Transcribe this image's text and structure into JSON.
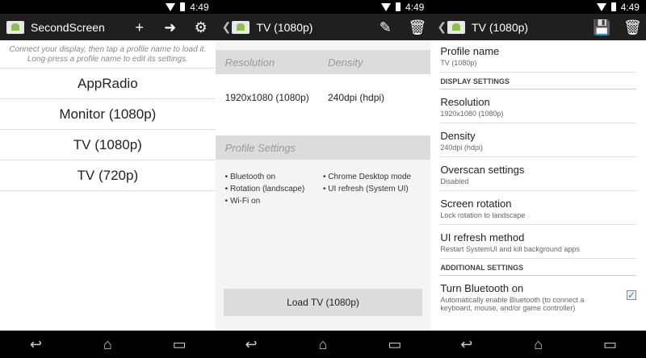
{
  "status": {
    "time": "4:49"
  },
  "screen1": {
    "title": "SecondScreen",
    "hint": "Connect your display, then tap a profile name to load it. Long-press a profile name to edit its settings.",
    "profiles": [
      "AppRadio",
      "Monitor (1080p)",
      "TV (1080p)",
      "TV (720p)"
    ]
  },
  "screen2": {
    "title": "TV (1080p)",
    "hdr": {
      "resolution": "Resolution",
      "density": "Density"
    },
    "vals": {
      "resolution": "1920x1080 (1080p)",
      "density": "240dpi (hdpi)"
    },
    "profile_settings": "Profile Settings",
    "bullets_left": [
      "Bluetooth on",
      "Rotation (landscape)",
      "Wi-Fi on"
    ],
    "bullets_right": [
      "Chrome Desktop mode",
      "UI refresh (System UI)"
    ],
    "load_button": "Load TV (1080p)"
  },
  "screen3": {
    "title": "TV (1080p)",
    "profile_name": {
      "title": "Profile name",
      "value": "TV (1080p)"
    },
    "cat_display": "DISPLAY SETTINGS",
    "resolution": {
      "title": "Resolution",
      "value": "1920x1080 (1080p)"
    },
    "density": {
      "title": "Density",
      "value": "240dpi (hdpi)"
    },
    "overscan": {
      "title": "Overscan settings",
      "value": "Disabled"
    },
    "rotation": {
      "title": "Screen rotation",
      "value": "Lock rotation to landscape"
    },
    "ui_refresh": {
      "title": "UI refresh method",
      "value": "Restart SystemUI and kill background apps"
    },
    "cat_additional": "ADDITIONAL SETTINGS",
    "bluetooth": {
      "title": "Turn Bluetooth on",
      "value": "Automatically enable Bluetooth (to connect a keyboard, mouse, and/or game controller)",
      "checked": true
    }
  }
}
